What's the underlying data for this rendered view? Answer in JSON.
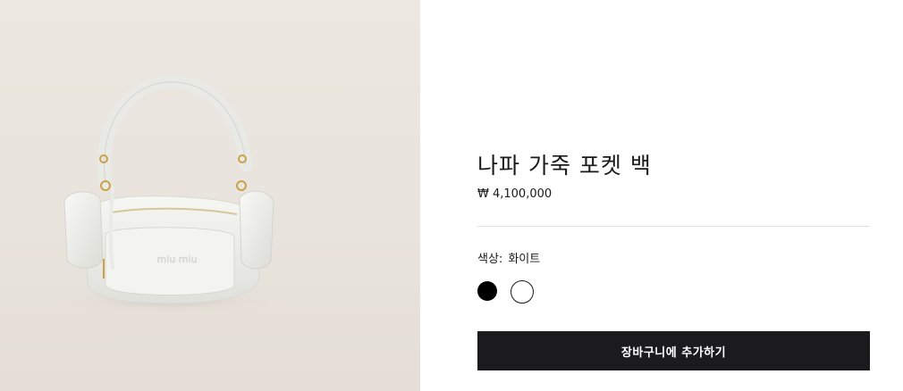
{
  "product": {
    "title": "나파 가죽 포켓 백",
    "price": "₩ 4,100,000",
    "color_label": "색상:",
    "color_value": "화이트",
    "swatches": [
      "black",
      "white"
    ],
    "add_to_cart_label": "장바구니에 추가하기"
  },
  "image": {
    "logo_text": "miu miu",
    "bag_color": "#f2f2ef",
    "hardware_color": "#c9a24a"
  },
  "colors": {
    "button_bg": "#1b1b1d",
    "background_panel": "#ebe6df"
  }
}
